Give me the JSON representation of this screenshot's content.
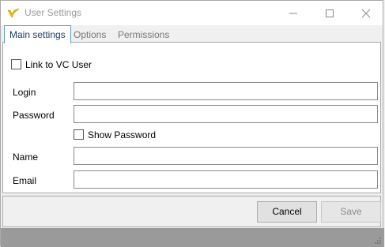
{
  "window": {
    "title": "User Settings",
    "icon": "app-logo-icon"
  },
  "tabs": [
    {
      "label": "Main settings",
      "active": true
    },
    {
      "label": "Options",
      "active": false
    },
    {
      "label": "Permissions",
      "active": false
    }
  ],
  "form": {
    "link_vc_user_label": "Link to VC User",
    "link_vc_user_checked": false,
    "login_label": "Login",
    "login_value": "",
    "password_label": "Password",
    "password_value": "",
    "show_password_label": "Show Password",
    "show_password_checked": false,
    "name_label": "Name",
    "name_value": "",
    "email_label": "Email",
    "email_value": ""
  },
  "buttons": {
    "cancel_label": "Cancel",
    "save_label": "Save",
    "save_enabled": false
  },
  "colors": {
    "accent": "#5b9bd5",
    "logo": "#f5c400"
  }
}
